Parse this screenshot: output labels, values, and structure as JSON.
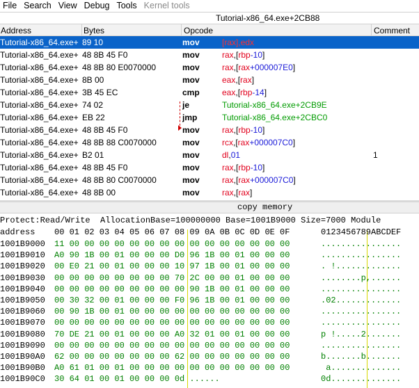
{
  "menu": [
    "File",
    "Search",
    "View",
    "Debug",
    "Tools",
    "Kernel tools"
  ],
  "address_bar": "Tutorial-x86_64.exe+2CB88",
  "columns": {
    "address": "Address",
    "bytes": "Bytes",
    "opcode": "Opcode",
    "comment": "Comment"
  },
  "disasm": [
    {
      "addr": "Tutorial-x86_64.exe+",
      "bytes": "89 10",
      "op": "mov",
      "args": [
        {
          "t": "[",
          "c": "reg"
        },
        {
          "t": "rax",
          "c": "reg"
        },
        {
          "t": "],",
          "c": "reg"
        },
        {
          "t": "edx",
          "c": "reg"
        }
      ],
      "comment": "",
      "selected": true
    },
    {
      "addr": "Tutorial-x86_64.exe+",
      "bytes": "48 8B 45 F0",
      "op": "mov",
      "args": [
        {
          "t": "rax",
          "c": "reg"
        },
        {
          "t": ",[",
          "c": "sym"
        },
        {
          "t": "rbp",
          "c": "reg"
        },
        {
          "t": "-10",
          "c": "num"
        },
        {
          "t": "]",
          "c": "sym"
        }
      ],
      "comment": ""
    },
    {
      "addr": "Tutorial-x86_64.exe+",
      "bytes": "48 8B 80 E0070000",
      "op": "mov",
      "args": [
        {
          "t": "rax",
          "c": "reg"
        },
        {
          "t": ",[",
          "c": "sym"
        },
        {
          "t": "rax",
          "c": "reg"
        },
        {
          "t": "+000007E0",
          "c": "num"
        },
        {
          "t": "]",
          "c": "sym"
        }
      ],
      "comment": ""
    },
    {
      "addr": "Tutorial-x86_64.exe+",
      "bytes": "8B 00",
      "op": "mov",
      "args": [
        {
          "t": "eax",
          "c": "reg"
        },
        {
          "t": ",[",
          "c": "sym"
        },
        {
          "t": "rax",
          "c": "reg"
        },
        {
          "t": "]",
          "c": "sym"
        }
      ],
      "comment": ""
    },
    {
      "addr": "Tutorial-x86_64.exe+",
      "bytes": "3B 45 EC",
      "op": "cmp",
      "args": [
        {
          "t": "eax",
          "c": "reg"
        },
        {
          "t": ",[",
          "c": "sym"
        },
        {
          "t": "rbp",
          "c": "reg"
        },
        {
          "t": "-14",
          "c": "num"
        },
        {
          "t": "]",
          "c": "sym"
        }
      ],
      "comment": ""
    },
    {
      "addr": "Tutorial-x86_64.exe+",
      "bytes": "74 02",
      "op": "je",
      "args": [
        {
          "t": "Tutorial-x86_64.exe+2CB9E",
          "c": "lbl"
        }
      ],
      "comment": ""
    },
    {
      "addr": "Tutorial-x86_64.exe+",
      "bytes": "EB 22",
      "op": "jmp",
      "args": [
        {
          "t": "Tutorial-x86_64.exe+2CBC0",
          "c": "lbl"
        }
      ],
      "comment": ""
    },
    {
      "addr": "Tutorial-x86_64.exe+",
      "bytes": "48 8B 45 F0",
      "op": "mov",
      "args": [
        {
          "t": "rax",
          "c": "reg"
        },
        {
          "t": ",[",
          "c": "sym"
        },
        {
          "t": "rbp",
          "c": "reg"
        },
        {
          "t": "-10",
          "c": "num"
        },
        {
          "t": "]",
          "c": "sym"
        }
      ],
      "comment": ""
    },
    {
      "addr": "Tutorial-x86_64.exe+",
      "bytes": "48 8B 88 C0070000",
      "op": "mov",
      "args": [
        {
          "t": "rcx",
          "c": "reg"
        },
        {
          "t": ",[",
          "c": "sym"
        },
        {
          "t": "rax",
          "c": "reg"
        },
        {
          "t": "+000007C0",
          "c": "num"
        },
        {
          "t": "]",
          "c": "sym"
        }
      ],
      "comment": ""
    },
    {
      "addr": "Tutorial-x86_64.exe+",
      "bytes": "B2 01",
      "op": "mov",
      "args": [
        {
          "t": "dl",
          "c": "reg"
        },
        {
          "t": ",",
          "c": "sym"
        },
        {
          "t": "01",
          "c": "num"
        }
      ],
      "comment": "1"
    },
    {
      "addr": "Tutorial-x86_64.exe+",
      "bytes": "48 8B 45 F0",
      "op": "mov",
      "args": [
        {
          "t": "rax",
          "c": "reg"
        },
        {
          "t": ",[",
          "c": "sym"
        },
        {
          "t": "rbp",
          "c": "reg"
        },
        {
          "t": "-10",
          "c": "num"
        },
        {
          "t": "]",
          "c": "sym"
        }
      ],
      "comment": ""
    },
    {
      "addr": "Tutorial-x86_64.exe+",
      "bytes": "48 8B 80 C0070000",
      "op": "mov",
      "args": [
        {
          "t": "rax",
          "c": "reg"
        },
        {
          "t": ",[",
          "c": "sym"
        },
        {
          "t": "rax",
          "c": "reg"
        },
        {
          "t": "+000007C0",
          "c": "num"
        },
        {
          "t": "]",
          "c": "sym"
        }
      ],
      "comment": ""
    },
    {
      "addr": "Tutorial-x86_64.exe+",
      "bytes": "48 8B 00",
      "op": "mov",
      "args": [
        {
          "t": "rax",
          "c": "reg"
        },
        {
          "t": ",[",
          "c": "sym"
        },
        {
          "t": "rax",
          "c": "reg"
        },
        {
          "t": "]",
          "c": "sym"
        }
      ],
      "comment": ""
    }
  ],
  "copy_memory_label": "copy memory",
  "hex_header": "Protect:Read/Write  AllocationBase=100000000 Base=1001B9000 Size=7000 Module",
  "hex_col_header": {
    "label": "address",
    "cols": "00 01 02 03 04 05 06 07 08 09 0A 0B 0C 0D 0E 0F",
    "ascii": "0123456789ABCDEF"
  },
  "hex_rows": [
    {
      "addr": "1001B9000",
      "bytes": "11 00 00 00 00 00 00 00 00 00 00 00 00 00 00 00",
      "ascii": "................"
    },
    {
      "addr": "1001B9010",
      "bytes": "A0 90 1B 00 01 00 00 00 D0 96 1B 00 01 00 00 00",
      "ascii": "................"
    },
    {
      "addr": "1001B9020",
      "bytes": "00 E0 21 00 01 00 00 00 10 97 1B 00 01 00 00 00",
      "ascii": ". !............."
    },
    {
      "addr": "1001B9030",
      "bytes": "00 00 00 00 00 00 00 00 70 2C 00 00 01 00 00 00",
      "ascii": "........p,......"
    },
    {
      "addr": "1001B9040",
      "bytes": "00 00 00 00 00 00 00 00 00 90 1B 00 01 00 00 00",
      "ascii": "................"
    },
    {
      "addr": "1001B9050",
      "bytes": "00 30 32 00 01 00 00 00 F0 96 1B 00 01 00 00 00",
      "ascii": ".02............."
    },
    {
      "addr": "1001B9060",
      "bytes": "00 90 1B 00 01 00 00 00 00 00 00 00 00 00 00 00",
      "ascii": "................"
    },
    {
      "addr": "1001B9070",
      "bytes": "00 00 00 00 00 00 00 00 00 00 00 00 00 00 00 00",
      "ascii": "................"
    },
    {
      "addr": "1001B9080",
      "bytes": "70 DE 21 00 01 00 00 00 A0 32 01 00 01 00 00 00",
      "ascii": "p !.....2......."
    },
    {
      "addr": "1001B9090",
      "bytes": "00 00 00 00 00 00 00 00 00 00 00 00 00 00 00 00",
      "ascii": "................"
    },
    {
      "addr": "1001B90A0",
      "bytes": "62 00 00 00 00 00 00 00 62 00 00 00 00 00 00 00",
      "ascii": "b.......b......."
    },
    {
      "addr": "1001B90B0",
      "bytes": "A0 61 01 00 01 00 00 00 00 00 00 00 00 00 00 00",
      "ascii": " a.............."
    },
    {
      "addr": "1001B90C0",
      "bytes": "30 64 01 00 01 00 00 00 0d ......",
      "ascii": "0d.............."
    }
  ]
}
